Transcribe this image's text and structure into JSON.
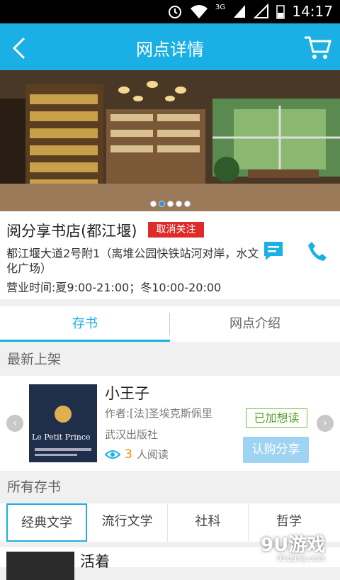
{
  "status_bar": {
    "time": "14:17",
    "network": "3G"
  },
  "header": {
    "title": "网点详情"
  },
  "banner": {
    "slide_count": 5,
    "active_slide": 1
  },
  "store": {
    "name": "阅分享书店(都江堰)",
    "unfollow_label": "取消关注",
    "address": "都江堰大道2号附1（离堆公园快铁站河对岸，水文化广场）",
    "hours": "营业时间:夏9:00-21:00；冬10:00-20:00"
  },
  "tabs": [
    {
      "label": "存书",
      "active": true
    },
    {
      "label": "网点介绍",
      "active": false
    }
  ],
  "sections": {
    "new_arrivals": "最新上架",
    "all_books": "所有存书"
  },
  "featured_book": {
    "title": "小王子",
    "author": "作者:[法]圣埃克斯佩里",
    "publisher": "武汉出版社",
    "read_count": "3",
    "read_suffix": "人阅读",
    "cover_text": "Le Petit Prince",
    "wanted_label": "已加想读",
    "buy_label": "认购分享"
  },
  "categories": [
    {
      "label": "经典文学",
      "active": true
    },
    {
      "label": "流行文学",
      "active": false
    },
    {
      "label": "社科",
      "active": false
    },
    {
      "label": "哲学",
      "active": false
    }
  ],
  "next_book": {
    "title": "活着"
  },
  "watermark": {
    "brand": "9U游戏",
    "url": "91danji.com"
  },
  "colors": {
    "accent": "#1ab0e6",
    "unfollow": "#e02a2a",
    "count": "#f08a00",
    "wanted": "#7ac043"
  }
}
